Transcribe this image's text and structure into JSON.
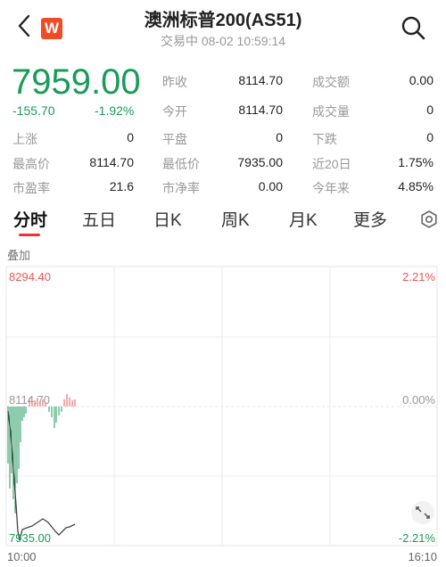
{
  "header": {
    "title": "澳洲标普200(AS51)",
    "status": "交易中 08-02 10:59:14",
    "logo_letter": "W"
  },
  "quote": {
    "price": "7959.00",
    "change": "-155.70",
    "change_pct": "-1.92%"
  },
  "stats": {
    "row1": [
      {
        "label": "昨收",
        "value": "8114.70"
      },
      {
        "label": "成交额",
        "value": "0.00"
      }
    ],
    "row2": [
      {
        "label": "今开",
        "value": "8114.70"
      },
      {
        "label": "成交量",
        "value": "0"
      }
    ],
    "row3": [
      {
        "label": "上涨",
        "value": "0"
      },
      {
        "label": "平盘",
        "value": "0"
      },
      {
        "label": "下跌",
        "value": "0"
      }
    ],
    "row4": [
      {
        "label": "最高价",
        "value": "8114.70"
      },
      {
        "label": "最低价",
        "value": "7935.00"
      },
      {
        "label": "近20日",
        "value": "1.75%"
      }
    ],
    "row5": [
      {
        "label": "市盈率",
        "value": "21.6"
      },
      {
        "label": "市净率",
        "value": "0.00"
      },
      {
        "label": "今年来",
        "value": "4.85%"
      }
    ]
  },
  "tabs": [
    "分时",
    "五日",
    "日K",
    "周K",
    "月K",
    "更多"
  ],
  "overlay_label": "叠加",
  "chart": {
    "y_top": "8294.40",
    "y_mid": "8114.70",
    "y_bottom": "7935.00",
    "pct_top": "2.21%",
    "pct_mid": "0.00%",
    "pct_bottom": "-2.21%",
    "x_start": "10:00",
    "x_end": "16:10"
  },
  "colors": {
    "up": "#e8595a",
    "down": "#1b9a59",
    "accent": "#e33333"
  },
  "icons": [
    "back-icon",
    "search-icon",
    "settings-icon",
    "expand-icon"
  ]
}
